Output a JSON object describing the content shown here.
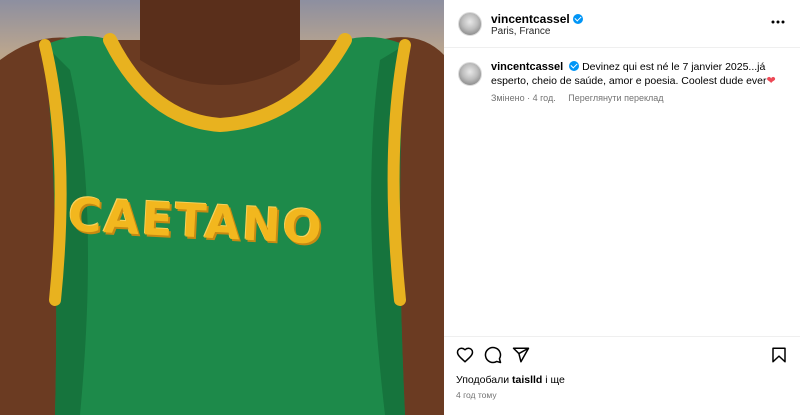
{
  "media": {
    "jersey_text": "CAETANO",
    "colors": {
      "jersey": "#1d8a4a",
      "trim": "#e8b21f",
      "skin": "#6b3b22"
    }
  },
  "post_header": {
    "username": "vincentcassel",
    "location": "Paris, France",
    "more_icon": "more-horizontal-icon"
  },
  "caption": {
    "username": "vincentcassel",
    "text": "Devinez qui est né le 7 janvier 2025...já esperto, cheio de saúde, amor e poesia. Coolest dude ever",
    "emoji": "❤",
    "edited_label": "Змінено",
    "time": "4 год.",
    "see_translation": "Переглянути переклад"
  },
  "actions": {
    "like_icon": "heart-icon",
    "comment_icon": "comment-icon",
    "share_icon": "share-icon",
    "save_icon": "bookmark-icon"
  },
  "likes": {
    "prefix": "Уподобали",
    "user": "taislld",
    "suffix": "і ще"
  },
  "timestamp": "4 год тому",
  "colors": {
    "verified": "#0095f6",
    "secondary_text": "#737373",
    "border": "#efefef"
  }
}
